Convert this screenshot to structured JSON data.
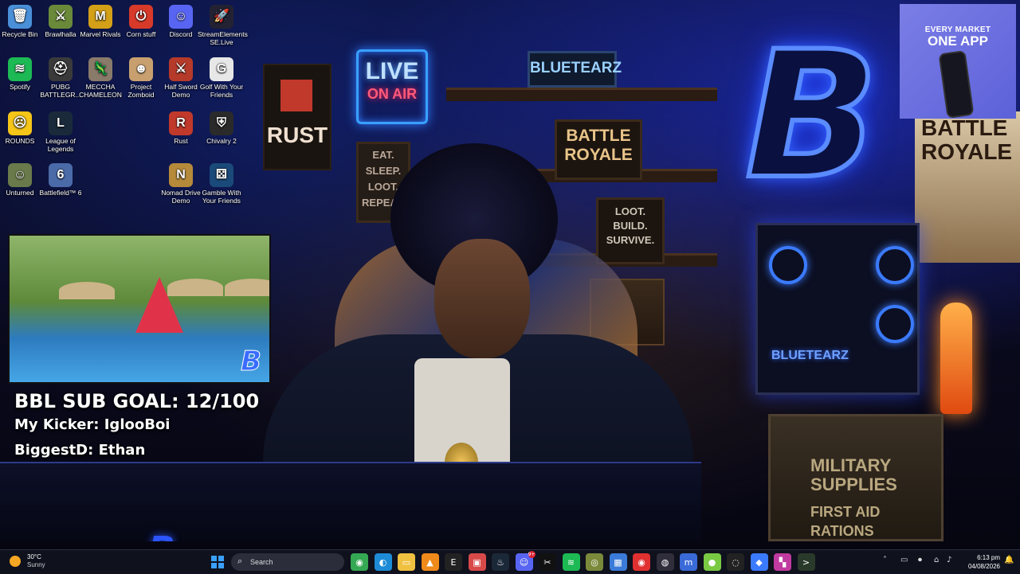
{
  "desktop": {
    "icons": [
      {
        "label": "Recycle Bin",
        "icon": "recycle-bin-icon",
        "color": "#4a90d9",
        "glyph": "🗑"
      },
      {
        "label": "Brawlhalla",
        "icon": "brawlhalla-icon",
        "color": "#6a8a3a",
        "glyph": "⚔"
      },
      {
        "label": "Marvel Rivals",
        "icon": "marvel-rivals-icon",
        "color": "#d4a017",
        "glyph": "M"
      },
      {
        "label": "Corn stuff",
        "icon": "corn-stuff-icon",
        "color": "#d83a2a",
        "glyph": "⏻"
      },
      {
        "label": "Discord",
        "icon": "discord-icon",
        "color": "#5865f2",
        "glyph": "☺"
      },
      {
        "label": "StreamElements SE.Live",
        "icon": "streamelements-icon",
        "color": "#223",
        "glyph": "🚀"
      },
      {
        "label": "Spotify",
        "icon": "spotify-icon",
        "color": "#1db954",
        "glyph": "≋"
      },
      {
        "label": "PUBG BATTLEGR...",
        "icon": "pubg-icon",
        "color": "#3a3a3a",
        "glyph": "⛑"
      },
      {
        "label": "MECCHA CHAMELEON",
        "icon": "meccha-chameleon-icon",
        "color": "#8a7a6a",
        "glyph": "🦎"
      },
      {
        "label": "Project Zomboid",
        "icon": "project-zomboid-icon",
        "color": "#c8a070",
        "glyph": "☻"
      },
      {
        "label": "Half Sword Demo",
        "icon": "half-sword-icon",
        "color": "#b53a2a",
        "glyph": "⚔"
      },
      {
        "label": "Golf With Your Friends",
        "icon": "golf-icon",
        "color": "#e7e7e7",
        "glyph": "G"
      },
      {
        "label": "ROUNDS",
        "icon": "rounds-icon",
        "color": "#f5c518",
        "glyph": "☹"
      },
      {
        "label": "League of Legends",
        "icon": "league-icon",
        "color": "#1a2a3a",
        "glyph": "L"
      },
      {
        "label": "Rust",
        "icon": "rust-icon",
        "color": "#c0392b",
        "glyph": "R"
      },
      {
        "label": "Chivalry 2",
        "icon": "chivalry-icon",
        "color": "#2a2a2a",
        "glyph": "⛨"
      },
      {
        "label": "Unturned",
        "icon": "unturned-icon",
        "color": "#6a7a4a",
        "glyph": "☺"
      },
      {
        "label": "Battlefield™ 6",
        "icon": "battlefield-icon",
        "color": "#4a6aa8",
        "glyph": "6"
      },
      {
        "label": "Nomad Drive Demo",
        "icon": "nomad-drive-icon",
        "color": "#b58a3a",
        "glyph": "N"
      },
      {
        "label": "Gamble With Your Friends",
        "icon": "gamble-icon",
        "color": "#1a4a7a",
        "glyph": "⚄"
      }
    ]
  },
  "wallpaper": {
    "live_sign": [
      "LIVE",
      "ON AIR"
    ],
    "rust_sign": "RUST",
    "bluetearz_top": "BLUETEARZ",
    "battle_royale": [
      "BATTLE",
      "ROYALE"
    ],
    "loot_sign": [
      "LOOT.",
      "BUILD.",
      "SURVIVE."
    ],
    "eat_sign": [
      "EAT.",
      "SLEEP.",
      "LOOT.",
      "REPEAT."
    ],
    "big_letter": "B",
    "poster": [
      "BATTLE",
      "ROYALE"
    ],
    "pc_label": "BLUETEARZ",
    "military": [
      "MILITARY",
      "SUPPLIES",
      "FIRST AID",
      "RATIONS"
    ],
    "desk_letter": "B"
  },
  "overlay": {
    "sub_goal": "BBL SUB GOAL: 12/100",
    "kicker": "My Kicker: IglooBoi",
    "biggest": "BiggestD: Ethan",
    "webcam_watermark": "B"
  },
  "ad": {
    "line1": "EVERY MARKET",
    "line2": "ONE APP"
  },
  "taskbar": {
    "weather_temp": "30°C",
    "weather_desc": "Sunny",
    "search_placeholder": "Search",
    "time": "6:13 pm",
    "date": "04/08/2026",
    "discord_badge": "9+",
    "apps": [
      {
        "name": "chrome-icon",
        "glyph": "◉",
        "color": "#34a853"
      },
      {
        "name": "edge-icon",
        "glyph": "◐",
        "color": "#1e8bd6"
      },
      {
        "name": "file-explorer-icon",
        "glyph": "▭",
        "color": "#f0c040"
      },
      {
        "name": "vlc-icon",
        "glyph": "▲",
        "color": "#f08a1a"
      },
      {
        "name": "epic-games-icon",
        "glyph": "E",
        "color": "#222"
      },
      {
        "name": "app-tile-icon",
        "glyph": "▣",
        "color": "#d84a4a"
      },
      {
        "name": "steam-icon",
        "glyph": "♨",
        "color": "#1b2838"
      },
      {
        "name": "discord-taskbar-icon",
        "glyph": "☺",
        "color": "#5865f2"
      },
      {
        "name": "capcut-icon",
        "glyph": "✂",
        "color": "#111"
      },
      {
        "name": "spotify-taskbar-icon",
        "glyph": "≋",
        "color": "#1db954"
      },
      {
        "name": "game-icon",
        "glyph": "◎",
        "color": "#7a8a3a"
      },
      {
        "name": "photos-icon",
        "glyph": "▦",
        "color": "#3a7ad8"
      },
      {
        "name": "red-app-icon",
        "glyph": "◉",
        "color": "#e03030"
      },
      {
        "name": "obs-icon",
        "glyph": "◍",
        "color": "#302e3a"
      },
      {
        "name": "mixer-icon",
        "glyph": "m",
        "color": "#3a6ad8"
      },
      {
        "name": "green-app-icon",
        "glyph": "●",
        "color": "#7ac943"
      },
      {
        "name": "obs-studio-icon",
        "glyph": "◌",
        "color": "#222"
      },
      {
        "name": "blue-diamond-icon",
        "glyph": "◆",
        "color": "#3a7aff"
      },
      {
        "name": "colorful-app-icon",
        "glyph": "▚",
        "color": "#c03aa0"
      },
      {
        "name": "terminal-icon",
        "glyph": ">",
        "color": "#2a3a2a"
      }
    ]
  }
}
